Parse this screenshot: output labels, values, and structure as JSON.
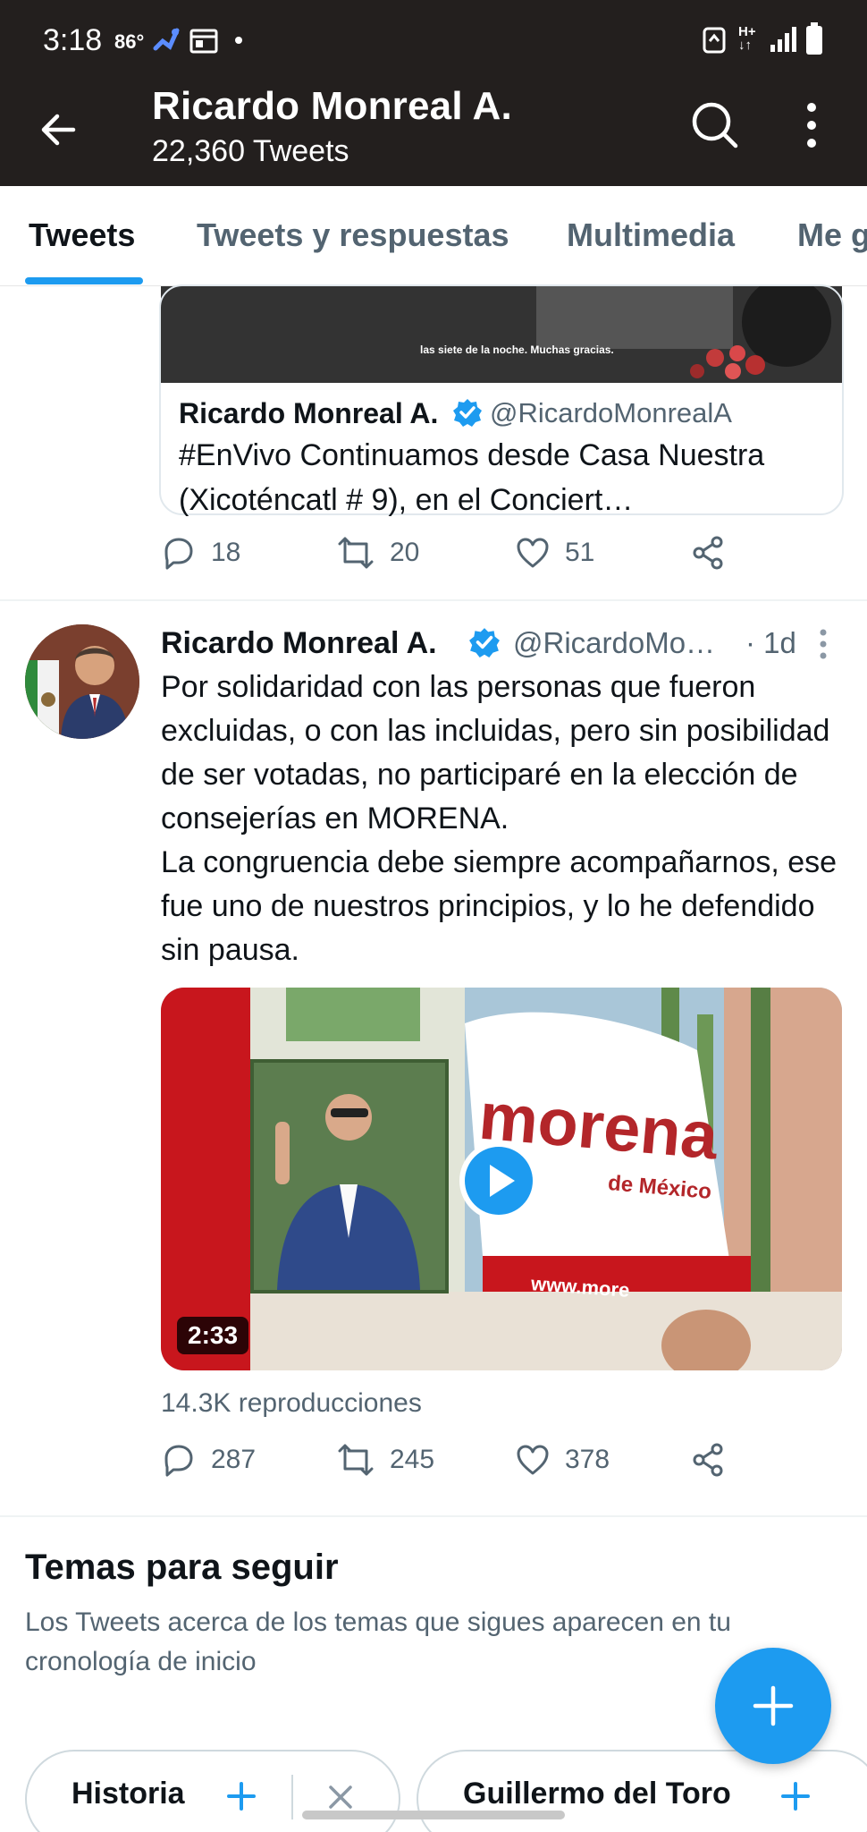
{
  "status_bar": {
    "time": "3:18",
    "temperature": "86°",
    "icons": [
      "brush-icon",
      "calendar-icon",
      "dot-icon",
      "recycle-icon",
      "hplus-signal-icon",
      "signal-bars-icon",
      "battery-icon"
    ]
  },
  "header": {
    "title": "Ricardo Monreal A.",
    "subtitle": "22,360 Tweets",
    "back_icon": "arrow-left-icon",
    "search_icon": "search-icon",
    "more_icon": "more-vertical-icon"
  },
  "tabs": [
    {
      "label": "Tweets",
      "active": true
    },
    {
      "label": "Tweets y respuestas",
      "active": false
    },
    {
      "label": "Multimedia",
      "active": false
    },
    {
      "label": "Me g",
      "active": false
    }
  ],
  "quoted_tweet": {
    "video_caption": "las siete de la noche. Muchas gracias.",
    "name": "Ricardo Monreal A.",
    "handle": "@RicardoMonrealA",
    "text": "#EnVivo Continuamos desde Casa Nuestra (Xicoténcatl # 9), en el Conciert…",
    "actions": {
      "replies": "18",
      "retweets": "20",
      "likes": "51"
    }
  },
  "tweet": {
    "name": "Ricardo Monreal A.",
    "handle": "@RicardoMo…",
    "time": "· 1d",
    "text": "Por solidaridad con las personas que fueron excluidas, o con las incluidas, pero sin posibilidad de ser votadas, no participaré en la elección de consejerías en MORENA.\nLa congruencia debe siempre acompañarnos, ese fue uno de nuestros principios, y lo he defendido sin pausa.",
    "media": {
      "banner_text": "morena",
      "banner_subtext": "de México",
      "banner_url": "www.more",
      "duration": "2:33"
    },
    "views": "14.3K reproducciones",
    "actions": {
      "replies": "287",
      "retweets": "245",
      "likes": "378"
    }
  },
  "topics": {
    "title": "Temas para seguir",
    "subtitle": "Los Tweets acerca de los temas que sigues aparecen en tu cronología de inicio",
    "chips": [
      {
        "label": "Historia"
      },
      {
        "label": "Guillermo del Toro"
      }
    ]
  },
  "fab": {
    "icon": "plus-icon"
  },
  "colors": {
    "accent": "#1d9bf0",
    "header_bg": "#231f1e",
    "muted": "#536471"
  }
}
